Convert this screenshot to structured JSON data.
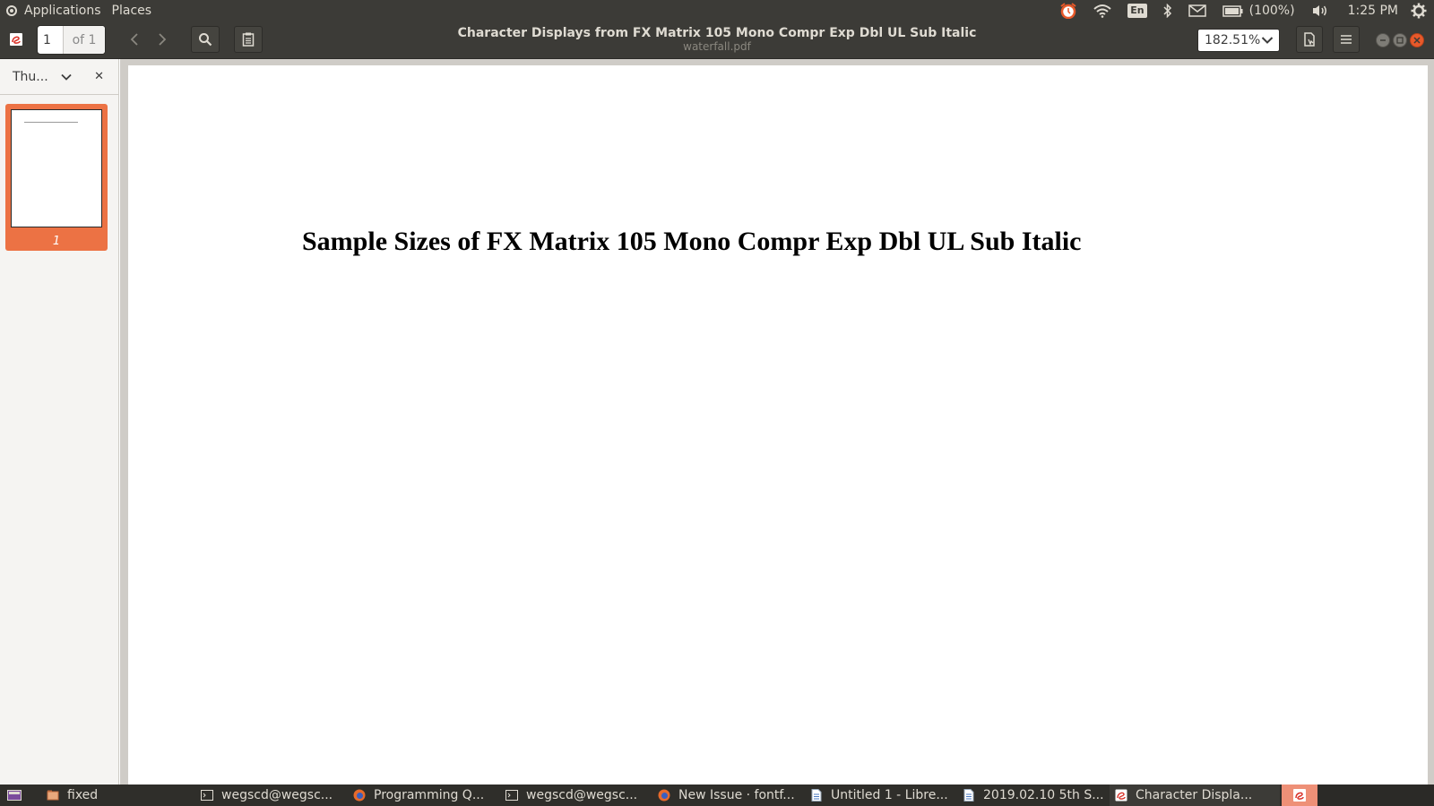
{
  "top_panel": {
    "menu": [
      "Applications",
      "Places"
    ],
    "battery_text": "(100%)",
    "keyboard_layout": "En",
    "clock": "1:25 PM",
    "icons": [
      "alarm-clock-icon",
      "wifi-icon",
      "bluetooth-icon",
      "mail-icon",
      "battery-icon",
      "volume-icon",
      "settings-gear-icon"
    ]
  },
  "header": {
    "page_number": "1",
    "page_total": "of 1",
    "title": "Character Displays from FX Matrix 105 Mono Compr Exp Dbl UL Sub Italic",
    "subtitle": "waterfall.pdf",
    "zoom": "182.51%",
    "icons": [
      "app-icon",
      "prev-page-icon",
      "next-page-icon",
      "search-icon",
      "annotations-icon",
      "print-icon",
      "menu-icon"
    ]
  },
  "sidebar": {
    "view_label": "Thu...",
    "thumbnails": [
      {
        "label": "1"
      }
    ]
  },
  "document": {
    "heading": "Sample Sizes of FX Matrix 105 Mono Compr Exp Dbl UL Sub Italic"
  },
  "taskbar": {
    "tasks": [
      {
        "label": "fixed",
        "icon": "folder-icon"
      },
      {
        "label": "wegscd@wegsc...",
        "icon": "terminal-icon"
      },
      {
        "label": "Programming Q...",
        "icon": "firefox-icon"
      },
      {
        "label": "wegscd@wegsc...",
        "icon": "terminal-icon"
      },
      {
        "label": "New Issue · fontf...",
        "icon": "firefox-icon"
      },
      {
        "label": "Untitled 1 - Libre...",
        "icon": "document-icon"
      },
      {
        "label": "2019.02.10 5th S...",
        "icon": "document-icon"
      },
      {
        "label": "Character Displa...",
        "icon": "pdf-viewer-icon"
      }
    ]
  },
  "colors": {
    "panel": "#3c3b37",
    "accent": "#ec7244",
    "close": "#e8592a",
    "page": "#ffffff"
  }
}
